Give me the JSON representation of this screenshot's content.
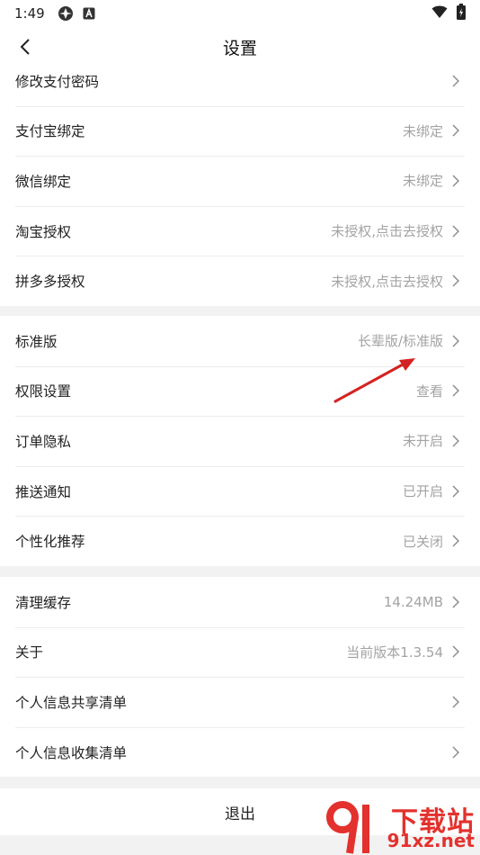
{
  "status_bar": {
    "time": "1:49"
  },
  "header": {
    "title": "设置"
  },
  "groups": [
    [
      {
        "label": "修改支付密码",
        "value": ""
      },
      {
        "label": "支付宝绑定",
        "value": "未绑定"
      },
      {
        "label": "微信绑定",
        "value": "未绑定"
      },
      {
        "label": "淘宝授权",
        "value": "未授权,点击去授权"
      },
      {
        "label": "拼多多授权",
        "value": "未授权,点击去授权"
      }
    ],
    [
      {
        "label": "标准版",
        "value": "长辈版/标准版"
      },
      {
        "label": "权限设置",
        "value": "查看"
      },
      {
        "label": "订单隐私",
        "value": "未开启"
      },
      {
        "label": "推送通知",
        "value": "已开启"
      },
      {
        "label": "个性化推荐",
        "value": "已关闭"
      }
    ],
    [
      {
        "label": "清理缓存",
        "value": "14.24MB"
      },
      {
        "label": "关于",
        "value": "当前版本1.3.54"
      },
      {
        "label": "个人信息共享清单",
        "value": ""
      },
      {
        "label": "个人信息收集清单",
        "value": ""
      }
    ]
  ],
  "logout_label": "退出",
  "watermark": {
    "top": "下载站",
    "bottom": "91xz.net"
  },
  "colors": {
    "annotation_arrow": "#d42222",
    "watermark": "#e3312d"
  }
}
